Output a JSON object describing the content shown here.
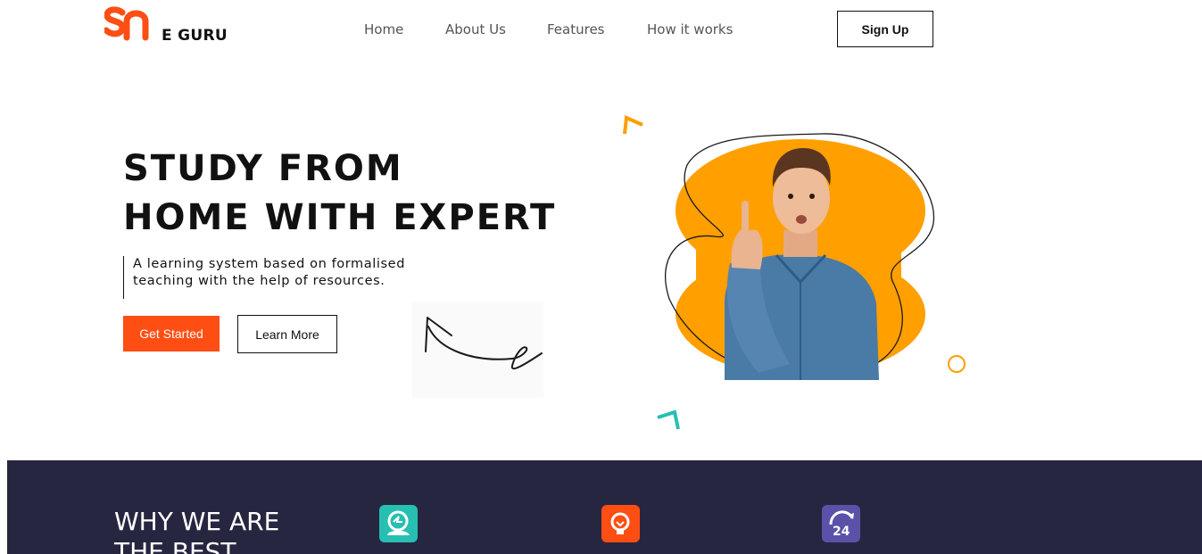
{
  "header": {
    "brand": "E GURU",
    "nav": [
      "Home",
      "About Us",
      "Features",
      "How it works"
    ],
    "signup_label": "Sign Up"
  },
  "hero": {
    "title_lines": [
      "STUDY FROM",
      "HOME WITH EXPERT"
    ],
    "description_lines": [
      "A learning system based on formalised",
      "teaching with the help of resources."
    ],
    "primary_button": "Get Started",
    "secondary_button": "Learn More"
  },
  "why": {
    "title_lines": [
      "WHY WE ARE",
      "THE BEST"
    ],
    "features": [
      {
        "icon": "support-agent-icon",
        "color": "#27bfb2"
      },
      {
        "icon": "lightbulb-icon",
        "color": "#ff4e13"
      },
      {
        "icon": "24-hours-icon",
        "color": "#5a52a8"
      }
    ]
  },
  "colors": {
    "accent": "#ff4e13",
    "orange": "#ff9f00",
    "teal": "#27bfb2",
    "dark_section": "#272640",
    "purple": "#5a52a8"
  }
}
